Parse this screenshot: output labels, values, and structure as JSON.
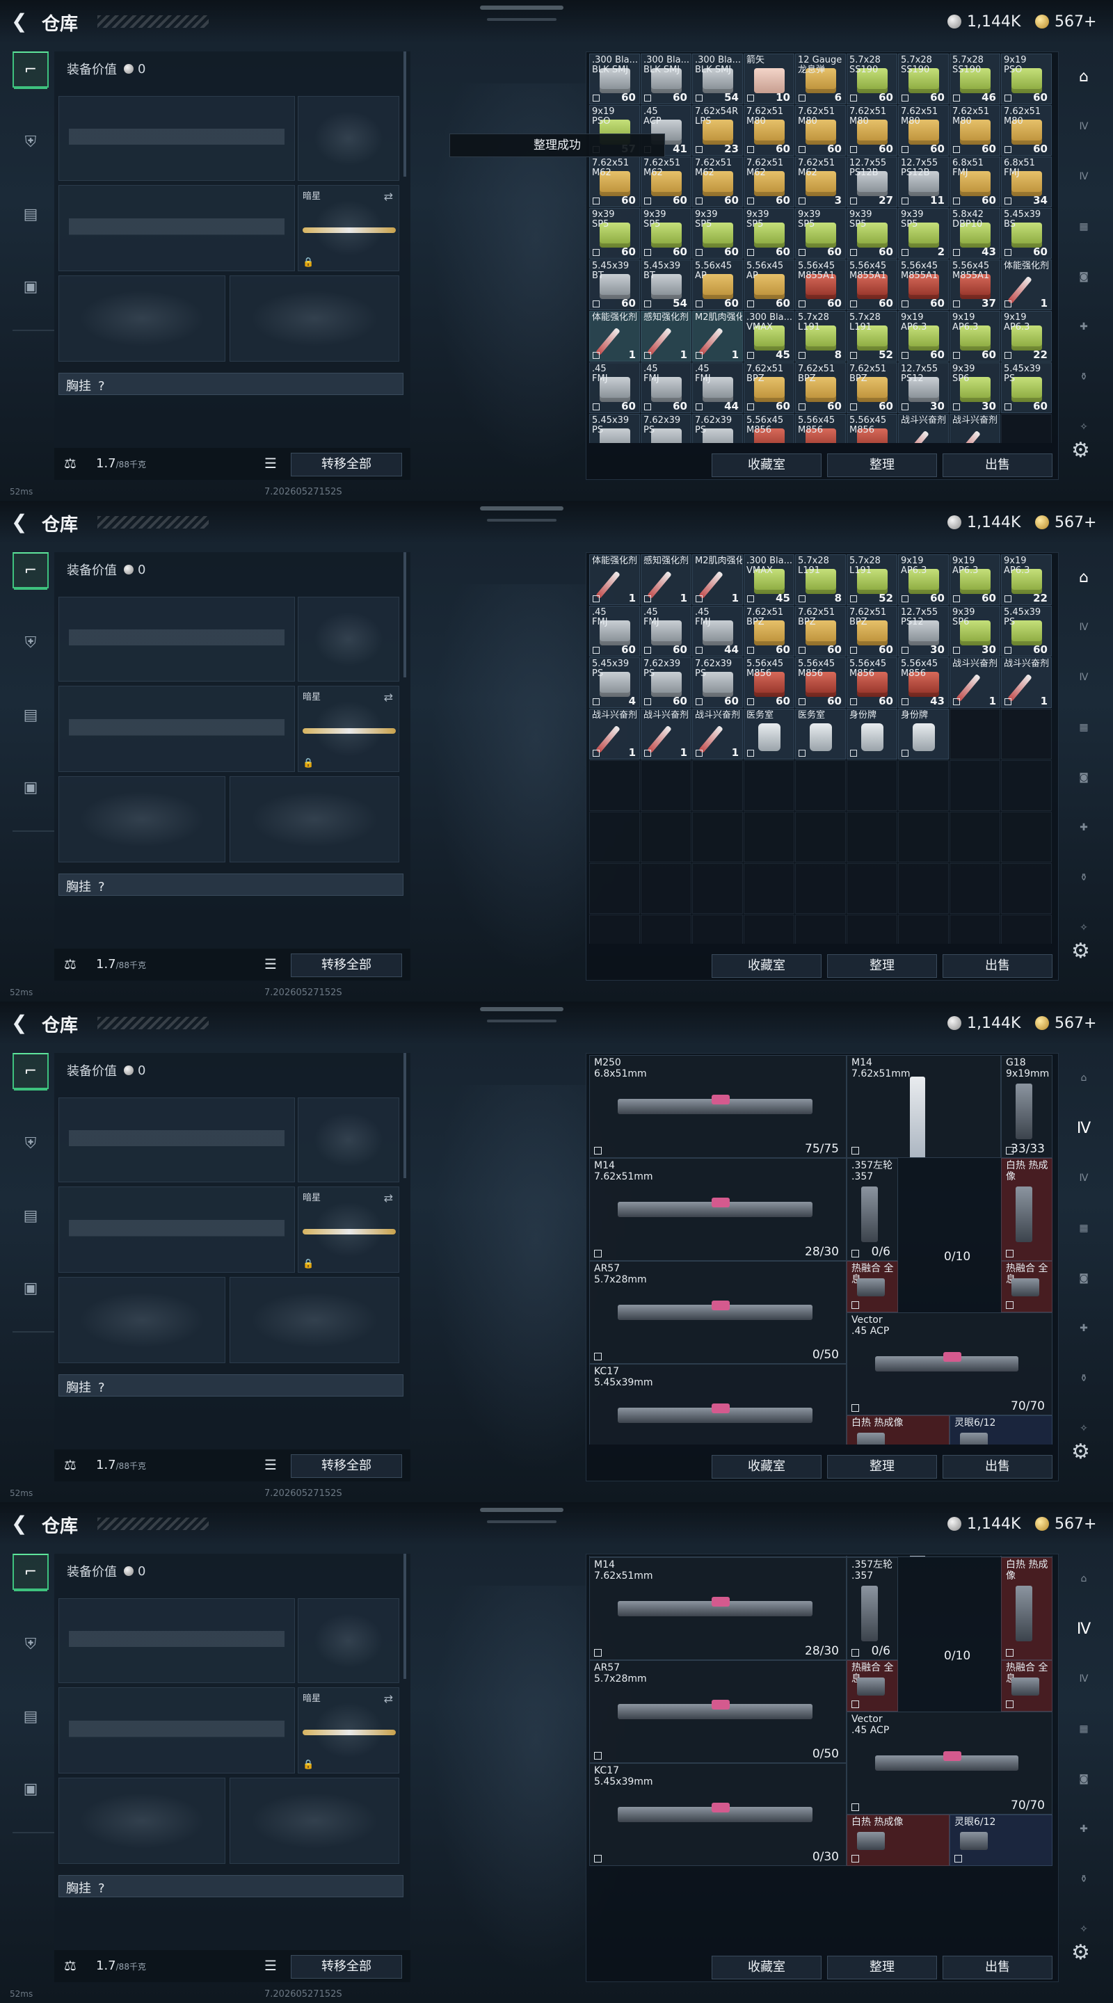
{
  "header": {
    "title": "仓库",
    "silver": "1,144K",
    "gold": "567+"
  },
  "footer": {
    "ping": "52ms",
    "version": "7.20260527152S"
  },
  "equipment": {
    "value_label": "装备价值",
    "value": "0",
    "secondary_label": "暗星",
    "rig_label": "胸挂",
    "rig_hint": "?",
    "weight": "1.7",
    "weight_max": "/88千克",
    "transfer_all": "转移全部"
  },
  "stash_buttons": {
    "favorites": "收藏室",
    "sort": "整理",
    "sell": "出售"
  },
  "toast": "整理成功",
  "left_tabs": [
    "weapon-tab-icon",
    "armor-tab-icon",
    "backpack-tab-icon",
    "case-tab-icon"
  ],
  "right_tabs": [
    "home-icon",
    "tier-iv-icon",
    "tier-iv-b-icon",
    "gallery-icon",
    "camera-icon",
    "medic-icon",
    "bottle-icon",
    "misc-icon"
  ],
  "palette": {
    "accent_green": "#3ec27e",
    "red_item": "#7a2424",
    "blue_item": "#2c3a64"
  },
  "frame1_items": [
    [
      ".300 Bla...",
      "BLK SMJ",
      "60",
      "grey"
    ],
    [
      ".300 Bla...",
      "BLK SMJ",
      "60",
      "grey"
    ],
    [
      ".300 Bla...",
      "BLK SMJ",
      "54",
      "grey"
    ],
    [
      "箭矢",
      "",
      "10",
      "pink"
    ],
    [
      "12 Gauge",
      "龙息弹",
      "6",
      "box"
    ],
    [
      "5.7x28",
      "SS190",
      "60",
      "green"
    ],
    [
      "5.7x28",
      "SS190",
      "60",
      "green"
    ],
    [
      "5.7x28",
      "SS190",
      "46",
      "green"
    ],
    [
      "9x19",
      "PSO",
      "60",
      "green"
    ],
    [
      "9x19",
      "PSO",
      "57",
      "green"
    ],
    [
      ".45",
      "ACP",
      "41",
      "grey"
    ],
    [
      "7.62x54R",
      "LPS",
      "23",
      "box"
    ],
    [
      "7.62x51",
      "M80",
      "60",
      "box"
    ],
    [
      "7.62x51",
      "M80",
      "60",
      "box"
    ],
    [
      "7.62x51",
      "M80",
      "60",
      "box"
    ],
    [
      "7.62x51",
      "M80",
      "60",
      "box"
    ],
    [
      "7.62x51",
      "M80",
      "60",
      "box"
    ],
    [
      "7.62x51",
      "M80",
      "60",
      "box"
    ],
    [
      "7.62x51",
      "M62",
      "60",
      "box"
    ],
    [
      "7.62x51",
      "M62",
      "60",
      "box"
    ],
    [
      "7.62x51",
      "M62",
      "60",
      "box"
    ],
    [
      "7.62x51",
      "M62",
      "60",
      "box"
    ],
    [
      "7.62x51",
      "M62",
      "3",
      "box"
    ],
    [
      "12.7x55",
      "PS12B",
      "27",
      "grey"
    ],
    [
      "12.7x55",
      "PS12B",
      "11",
      "grey"
    ],
    [
      "6.8x51",
      "FMJ",
      "60",
      "box"
    ],
    [
      "6.8x51",
      "FMJ",
      "34",
      "box"
    ],
    [
      "9x39",
      "SP5",
      "60",
      "green"
    ],
    [
      "9x39",
      "SP5",
      "60",
      "green"
    ],
    [
      "9x39",
      "SP5",
      "60",
      "green"
    ],
    [
      "9x39",
      "SP5",
      "60",
      "green"
    ],
    [
      "9x39",
      "SP5",
      "60",
      "green"
    ],
    [
      "9x39",
      "SP5",
      "60",
      "green"
    ],
    [
      "9x39",
      "SP5",
      "2",
      "green"
    ],
    [
      "5.8x42",
      "DBP10",
      "43",
      "green"
    ],
    [
      "5.45x39",
      "BS",
      "60",
      "green"
    ],
    [
      "5.45x39",
      "BT",
      "60",
      "grey"
    ],
    [
      "5.45x39",
      "BT",
      "54",
      "grey"
    ],
    [
      "5.56x45",
      "AP",
      "60",
      "box"
    ],
    [
      "5.56x45",
      "AP",
      "60",
      "box"
    ],
    [
      "5.56x45",
      "M855A1",
      "60",
      "red"
    ],
    [
      "5.56x45",
      "M855A1",
      "60",
      "red"
    ],
    [
      "5.56x45",
      "M855A1",
      "60",
      "red"
    ],
    [
      "5.56x45",
      "M855A1",
      "37",
      "red"
    ],
    [
      "体能强化剂",
      "",
      "1",
      "syr"
    ],
    [
      "体能强化剂",
      "",
      "1",
      "syr"
    ],
    [
      "感知强化剂",
      "",
      "1",
      "syr"
    ],
    [
      "M2肌肉强化",
      "",
      "1",
      "syr"
    ],
    [
      ".300 Bla...",
      "VMAX",
      "45",
      "green"
    ],
    [
      "5.7x28",
      "L191",
      "8",
      "green"
    ],
    [
      "5.7x28",
      "L191",
      "52",
      "green"
    ],
    [
      "9x19",
      "AP6.3",
      "60",
      "green"
    ],
    [
      "9x19",
      "AP6.3",
      "60",
      "green"
    ],
    [
      "9x19",
      "AP6.3",
      "22",
      "green"
    ],
    [
      ".45",
      "FMJ",
      "60",
      "grey"
    ],
    [
      ".45",
      "FMJ",
      "60",
      "grey"
    ],
    [
      ".45",
      "FMJ",
      "44",
      "grey"
    ],
    [
      "7.62x51",
      "BPZ",
      "60",
      "box"
    ],
    [
      "7.62x51",
      "BPZ",
      "60",
      "box"
    ],
    [
      "7.62x51",
      "BPZ",
      "60",
      "box"
    ],
    [
      "12.7x55",
      "PS12",
      "30",
      "grey"
    ],
    [
      "9x39",
      "SP6",
      "30",
      "green"
    ],
    [
      "5.45x39",
      "PS",
      "60",
      "green"
    ],
    [
      "5.45x39",
      "PS",
      "4",
      "grey"
    ],
    [
      "7.62x39",
      "PS",
      "60",
      "grey"
    ],
    [
      "7.62x39",
      "PS",
      "60",
      "grey"
    ],
    [
      "5.56x45",
      "M856",
      "60",
      "red"
    ],
    [
      "5.56x45",
      "M856",
      "60",
      "red"
    ],
    [
      "5.56x45",
      "M856",
      "43",
      "red"
    ],
    [
      "战斗兴奋剂",
      "",
      "1",
      "syr"
    ],
    [
      "战斗兴奋剂",
      "",
      "1",
      "syr"
    ],
    [
      "",
      "",
      "",
      ""
    ]
  ],
  "frame2_items": [
    [
      "体能强化剂",
      "",
      "1",
      "syr"
    ],
    [
      "感知强化剂",
      "",
      "1",
      "syr"
    ],
    [
      "M2肌肉强化",
      "",
      "1",
      "syr"
    ],
    [
      ".300 Bla...",
      "VMAX",
      "45",
      "green"
    ],
    [
      "5.7x28",
      "L191",
      "8",
      "green"
    ],
    [
      "5.7x28",
      "L191",
      "52",
      "green"
    ],
    [
      "9x19",
      "AP6.3",
      "60",
      "green"
    ],
    [
      "9x19",
      "AP6.3",
      "60",
      "green"
    ],
    [
      "9x19",
      "AP6.3",
      "22",
      "green"
    ],
    [
      ".45",
      "FMJ",
      "60",
      "grey"
    ],
    [
      ".45",
      "FMJ",
      "60",
      "grey"
    ],
    [
      ".45",
      "FMJ",
      "44",
      "grey"
    ],
    [
      "7.62x51",
      "BPZ",
      "60",
      "box"
    ],
    [
      "7.62x51",
      "BPZ",
      "60",
      "box"
    ],
    [
      "7.62x51",
      "BPZ",
      "60",
      "box"
    ],
    [
      "12.7x55",
      "PS12",
      "30",
      "grey"
    ],
    [
      "9x39",
      "SP6",
      "30",
      "green"
    ],
    [
      "5.45x39",
      "PS",
      "60",
      "green"
    ],
    [
      "5.45x39",
      "PS",
      "4",
      "grey"
    ],
    [
      "7.62x39",
      "PS",
      "60",
      "grey"
    ],
    [
      "7.62x39",
      "PS",
      "60",
      "grey"
    ],
    [
      "5.56x45",
      "M856",
      "60",
      "red"
    ],
    [
      "5.56x45",
      "M856",
      "60",
      "red"
    ],
    [
      "5.56x45",
      "M856",
      "60",
      "red"
    ],
    [
      "5.56x45",
      "M856",
      "43",
      "red"
    ],
    [
      "战斗兴奋剂",
      "",
      "1",
      "syr"
    ],
    [
      "战斗兴奋剂",
      "",
      "1",
      "syr"
    ],
    [
      "战斗兴奋剂",
      "",
      "1",
      "syr"
    ],
    [
      "战斗兴奋剂",
      "",
      "1",
      "syr"
    ],
    [
      "战斗兴奋剂",
      "",
      "1",
      "syr"
    ],
    [
      "医务室",
      "",
      "",
      "tag"
    ],
    [
      "医务室",
      "",
      "",
      "tag"
    ],
    [
      "身份牌",
      "",
      "",
      "tag"
    ],
    [
      "身份牌",
      "",
      "",
      "tag"
    ]
  ],
  "weapons": [
    {
      "name": "M250\n6.8x51mm",
      "count": "75/75"
    },
    {
      "name": "M14\n7.62x51mm",
      "count": ""
    },
    {
      "name": "G18\n9x19mm",
      "count": "33/33"
    },
    {
      "name": "M14\n7.62x51mm",
      "count": "28/30"
    },
    {
      "name": ".357左轮\n.357",
      "count": "0/6"
    },
    {
      "name": "白热 热成像",
      "count": ""
    },
    {
      "name": "AR57\n5.7x28mm",
      "count": "0/50"
    },
    {
      "name": "热融合 全息",
      "count": ""
    },
    {
      "name": "热融合 全息",
      "count": ""
    },
    {
      "name": "Vector\n.45 ACP",
      "count": "70/70"
    },
    {
      "name": "KC17\n5.45x39mm",
      "count": "0/30"
    },
    {
      "name": "白热 热成像",
      "count": ""
    },
    {
      "name": "灵眼6/12",
      "count": ""
    },
    {
      "name": "M14",
      "count": "0/10"
    }
  ]
}
